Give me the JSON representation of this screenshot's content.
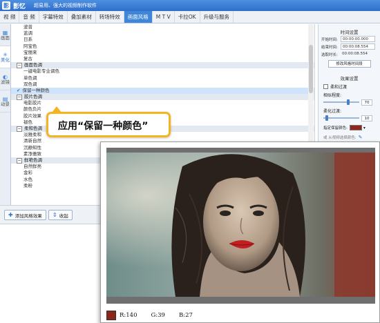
{
  "titlebar": {
    "logo": "影",
    "app_name": "影忆",
    "slogan": "超易用、强大的视频制作软件"
  },
  "menu": {
    "tabs": [
      "视  频",
      "音  频",
      "字幕特效",
      "叠加素材",
      "转场特效",
      "画面风格",
      "M T V",
      "卡拉OK",
      "升级与服务"
    ],
    "active_index": 5
  },
  "vtabs": [
    {
      "icon": "grid-icon",
      "label": "画面"
    },
    {
      "icon": "sparkle-icon",
      "label": "美化"
    },
    {
      "icon": "filter-icon",
      "label": "滤镜"
    },
    {
      "icon": "motion-icon",
      "label": "动景"
    }
  ],
  "effects": {
    "rows": [
      {
        "text": "波普",
        "type": "item"
      },
      {
        "text": "蓝调",
        "type": "item"
      },
      {
        "text": "日系",
        "type": "item"
      },
      {
        "text": "阿宝色",
        "type": "item"
      },
      {
        "text": "宝丽来",
        "type": "item"
      },
      {
        "text": "复古",
        "type": "item"
      },
      {
        "text": "画面色调",
        "type": "group"
      },
      {
        "text": "一键电影专业调色",
        "type": "item"
      },
      {
        "text": "单色调",
        "type": "item"
      },
      {
        "text": "双色调",
        "type": "item"
      },
      {
        "text": "保留一种颜色",
        "type": "selected"
      },
      {
        "text": "胶片色调",
        "type": "group"
      },
      {
        "text": "电影胶片",
        "type": "item"
      },
      {
        "text": "颜色负片",
        "type": "item"
      },
      {
        "text": "胶片效果",
        "type": "item"
      },
      {
        "text": "褪色",
        "type": "item"
      },
      {
        "text": "柔和色调",
        "type": "group"
      },
      {
        "text": "淡雅柔和",
        "type": "item"
      },
      {
        "text": "清新自然",
        "type": "item"
      },
      {
        "text": "沉静知性",
        "type": "item"
      },
      {
        "text": "素净雅致",
        "type": "item"
      },
      {
        "text": "鲜艳色调",
        "type": "group"
      },
      {
        "text": "自然鲜亮",
        "type": "item"
      },
      {
        "text": "金彩",
        "type": "item"
      },
      {
        "text": "水色",
        "type": "item"
      },
      {
        "text": "柔粉",
        "type": "item"
      }
    ],
    "check_mark": "✔"
  },
  "bottombar": {
    "add_label": "添加风格效果",
    "collapse_label": "收起"
  },
  "right": {
    "time_title": "时间设置",
    "start_label": "开始时间:",
    "start_value": "00:00:00.000",
    "end_label": "结束时间:",
    "end_value": "00:00:08.554",
    "dur_label": "选取时长:",
    "dur_value": "00:00:08.554",
    "time_btn": "修改风格时间段",
    "effect_title": "效果设置",
    "soft_label": "柔和过渡",
    "similarity_label": "相似程度:",
    "similarity_value": "70",
    "similarity_level": 0.7,
    "softness_label": "柔化过渡:",
    "softness_value": "10",
    "softness_level": 0.1,
    "keep_color_label": "指定保留颜色:",
    "keep_color": "#8c2720",
    "pick_prefix": "或",
    "pick_label": "从视频选择颜色:"
  },
  "callout": {
    "text": "应用“保留一种颜色”"
  },
  "preview": {
    "readout_color": "#8c271b",
    "r": "R:140",
    "g": "G:39",
    "b": "B:27"
  }
}
